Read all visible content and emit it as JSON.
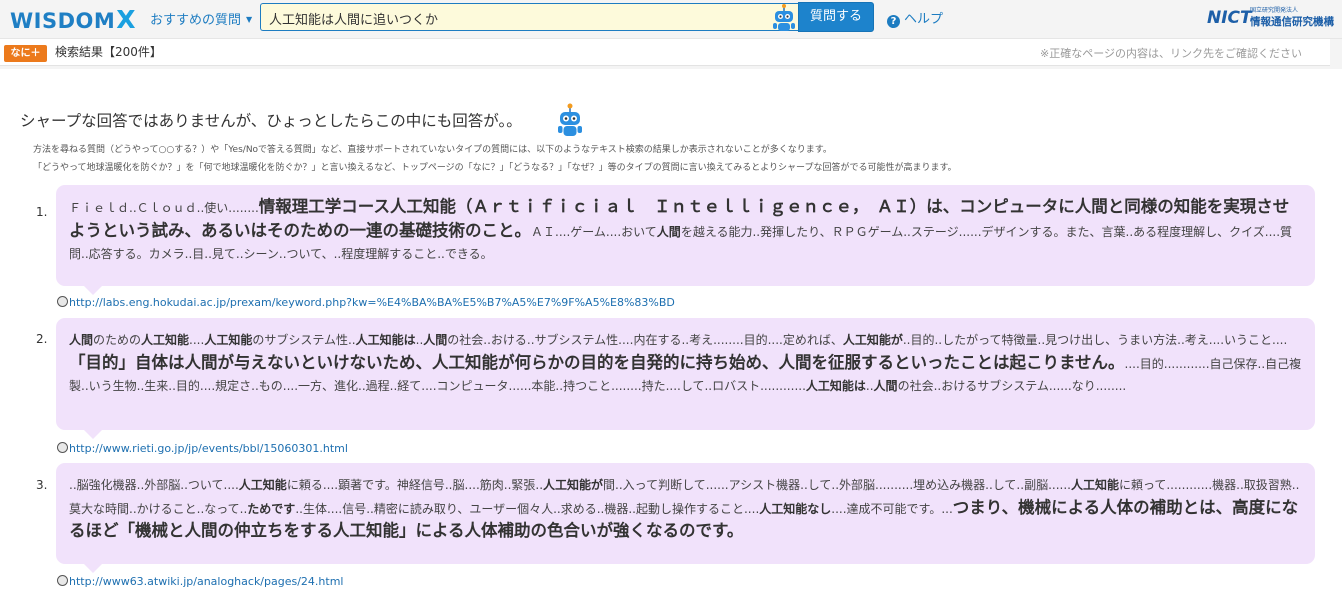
{
  "header": {
    "logo_text": "WISDOM",
    "logo_x": "X",
    "recommend_label": "おすすめの質問",
    "search_value": "人工知能は人間に追いつくか",
    "ask_button": "質問する",
    "help_label": "ヘルプ",
    "org_mark": "NICT",
    "org_sub": "国立研究開発法人",
    "org_name": "情報通信研究機構"
  },
  "subbar": {
    "nani_label": "なに＋",
    "result_count": "検索結果【200件】",
    "notice": "※正確なページの内容は、リンク先をご確認ください"
  },
  "intro": {
    "heading": "シャープな回答ではありませんが、ひょっとしたらこの中にも回答が。。",
    "note1": "方法を尋ねる質問（どうやって○○する？）や「Yes/Noで答える質問」など、直接サポートされていないタイプの質問には、以下のようなテキスト検索の結果しか表示されないことが多くなります。",
    "note2": "「どうやって地球温暖化を防ぐか？」を「何で地球温暖化を防ぐか？」と言い換えるなど、トップページの「なに？」「どうなる？」「なぜ？」等のタイプの質問に言い換えてみるとよりシャープな回答がでる可能性が高まります。"
  },
  "results": [
    {
      "num": "1.",
      "segments": [
        {
          "t": "Ｆｉｅｌｄ..Ｃｌｏｕｄ..使い........",
          "s": "n"
        },
        {
          "t": "情報理工学コース人工知能（Ａｒｔｉｆｉｃｉａｌ　Ｉｎｔｅｌｌｉｇｅｎｃｅ，　ＡＩ）は、コンピュータに人間と同様の知能を実現させようという試み、あるいはそのための一連の基礎技術のこと。",
          "s": "h"
        },
        {
          "t": "ＡＩ....ゲーム....おいて",
          "s": "n"
        },
        {
          "t": "人間",
          "s": "k"
        },
        {
          "t": "を越える能力..発揮したり、ＲＰＧゲーム..ステージ......デザインする。また、言葉..ある程度理解し、クイズ....質問..応答する。カメラ..目..見て..シーン..ついて、..程度理解すること..できる。",
          "s": "n"
        }
      ],
      "url": "http://labs.eng.hokudai.ac.jp/prexam/keyword.php?kw=%E4%BA%BA%E5%B7%A5%E7%9F%A5%E8%83%BD"
    },
    {
      "num": "2.",
      "segments": [
        {
          "t": "人間",
          "s": "k"
        },
        {
          "t": "のための",
          "s": "n"
        },
        {
          "t": "人工知能",
          "s": "k"
        },
        {
          "t": "....",
          "s": "n"
        },
        {
          "t": "人工知能",
          "s": "k"
        },
        {
          "t": "のサブシステム性..",
          "s": "n"
        },
        {
          "t": "人工知能は",
          "s": "k"
        },
        {
          "t": "..",
          "s": "n"
        },
        {
          "t": "人間",
          "s": "k"
        },
        {
          "t": "の社会..おける..サブシステム性....内在する..考え........目的....定めれば、",
          "s": "n"
        },
        {
          "t": "人工知能が",
          "s": "k"
        },
        {
          "t": "..目的..したがって特徴量..見つけ出し、うまい方法..考え....いうこと....",
          "s": "n"
        },
        {
          "t": "「目的」自体は人間が与えないといけないため、人工知能が何らかの目的を自発的に持ち始め、人間を征服するといったことは起こりません。",
          "s": "h"
        },
        {
          "t": "....目的............自己保存..自己複製..いう生物..生来..目的....規定さ..もの....一方、進化..過程..経て....コンピュータ......本能..持つこと........持た....して..ロバスト............",
          "s": "n"
        },
        {
          "t": "人工知能は",
          "s": "k"
        },
        {
          "t": "..",
          "s": "n"
        },
        {
          "t": "人間",
          "s": "k"
        },
        {
          "t": "の社会..おけるサブシステム......なり........",
          "s": "n"
        }
      ],
      "url": "http://www.rieti.go.jp/jp/events/bbl/15060301.html"
    },
    {
      "num": "3.",
      "segments": [
        {
          "t": "..脳強化機器..外部脳..ついて....",
          "s": "n"
        },
        {
          "t": "人工知能",
          "s": "k"
        },
        {
          "t": "に頼る....顕著です。神経信号..脳....筋肉..緊張..",
          "s": "n"
        },
        {
          "t": "人工知能が",
          "s": "k"
        },
        {
          "t": "間..入って判断して......アシスト機器..して..外部脳..........埋め込み機器..して..副脳......",
          "s": "n"
        },
        {
          "t": "人工知能",
          "s": "k"
        },
        {
          "t": "に頼って............機器..取扱習熟..莫大な時間..かけること..なって..",
          "s": "n"
        },
        {
          "t": "ためです",
          "s": "k"
        },
        {
          "t": "..生体....信号..精密に読み取り、ユーザー個々人..求める..機器..起動し操作すること....",
          "s": "n"
        },
        {
          "t": "人工知能なし",
          "s": "k"
        },
        {
          "t": "....達成不可能です。...",
          "s": "n"
        },
        {
          "t": "つまり、機械による人体の補助とは、高度になるほど「機械と人間の仲立ちをする人工知能」による人体補助の色合いが強くなるのです。",
          "s": "h"
        }
      ],
      "url": "http://www63.atwiki.jp/analoghack/pages/24.html"
    }
  ]
}
